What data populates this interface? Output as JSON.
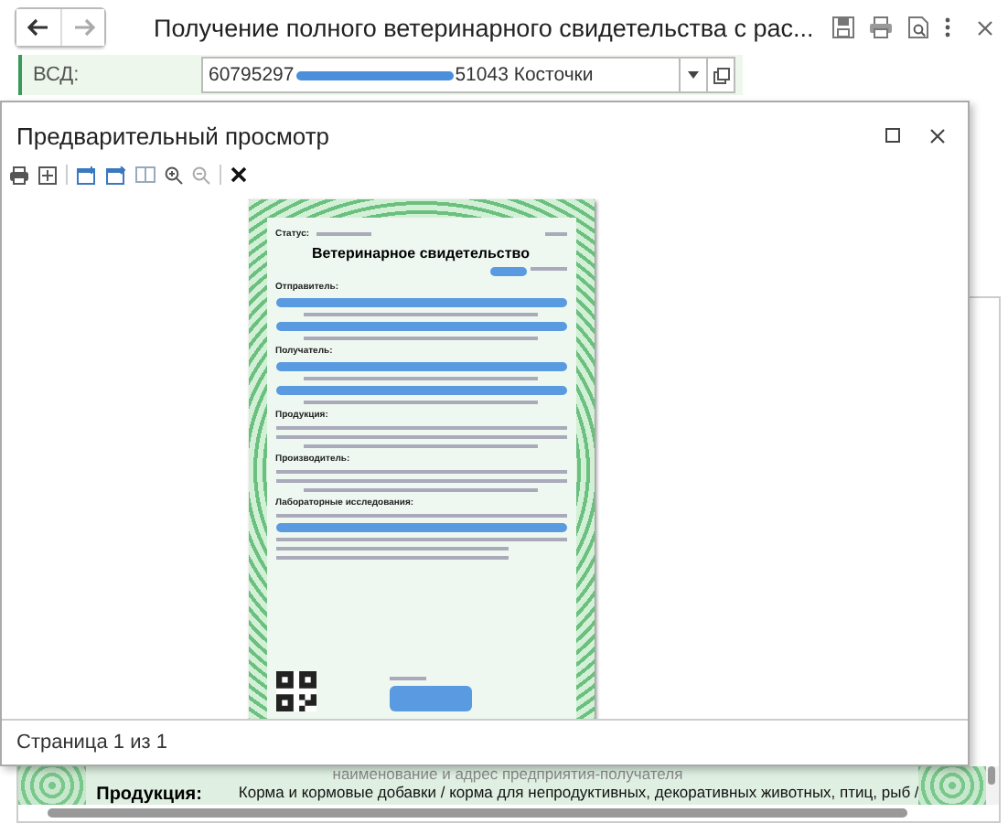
{
  "window": {
    "title": "Получение полного ветеринарного свидетельства с рас..."
  },
  "vsd_field": {
    "label": "ВСД:",
    "value_start": "60795297",
    "value_end": "51043 Косточки"
  },
  "background_document": {
    "caption": "наименование и адрес предприятия-получателя",
    "label": "Продукция:",
    "text": "Корма и кормовые добавки / корма для непродуктивных, декоративных животных, птиц, рыб /"
  },
  "preview": {
    "title": "Предварительный просмотр",
    "page": {
      "status_label": "Статус:",
      "heading": "Ветеринарное свидетельство",
      "sections": [
        {
          "label": "Отправитель:",
          "kind": "redacted"
        },
        {
          "label": "Получатель:",
          "kind": "redacted"
        },
        {
          "label": "Продукция:",
          "kind": "text"
        },
        {
          "label": "Производитель:",
          "kind": "text"
        },
        {
          "label": "Лабораторные исследования:",
          "kind": "mixed"
        }
      ]
    },
    "status_bar": "Страница 1 из 1"
  }
}
